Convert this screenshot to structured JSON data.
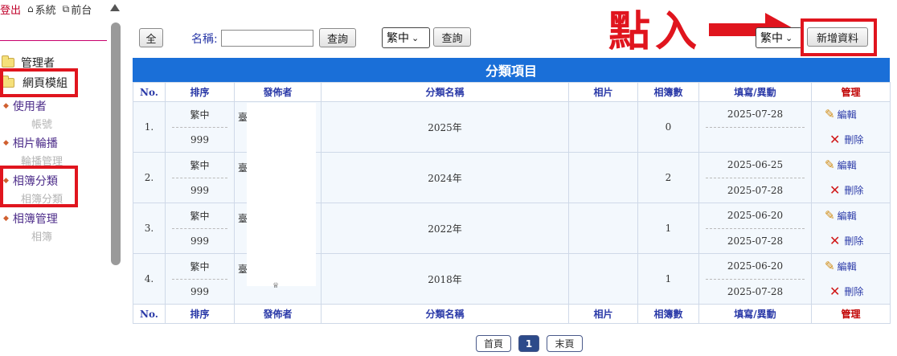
{
  "sidebar": {
    "logout": "登出",
    "system": "系統",
    "frontend": "前台",
    "folders": {
      "admin": "管理者",
      "web_module": "網頁模組"
    },
    "items": [
      {
        "label": "使用者",
        "sub": "帳號"
      },
      {
        "label": "相片輪播",
        "sub": "輪播管理"
      },
      {
        "label": "相簿分類",
        "sub": "相簿分類"
      },
      {
        "label": "相簿管理",
        "sub": "相簿"
      }
    ]
  },
  "toolbar": {
    "all_button": "全",
    "name_label": "名稱:",
    "name_value": "",
    "search_button": "查詢",
    "lang_select": "繁中",
    "search_button_2": "查詢",
    "lang_select_2": "繁中",
    "add_button": "新增資料"
  },
  "annotation": {
    "text": "點入"
  },
  "table": {
    "title": "分類項目",
    "headers": {
      "no": "No.",
      "order": "排序",
      "publisher": "發佈者",
      "category": "分類名稱",
      "photo": "相片",
      "album_count": "相簿數",
      "date": "填寫/異動",
      "manage": "管理"
    },
    "rows": [
      {
        "no": "1.",
        "lang": "繁中",
        "order": "999",
        "publisher": "臺",
        "category": "2025年",
        "photo": "",
        "album_count": "0",
        "created": "2025-07-28",
        "modified": ""
      },
      {
        "no": "2.",
        "lang": "繁中",
        "order": "999",
        "publisher": "臺",
        "category": "2024年",
        "photo": "",
        "album_count": "2",
        "created": "2025-06-25",
        "modified": "2025-07-28"
      },
      {
        "no": "3.",
        "lang": "繁中",
        "order": "999",
        "publisher": "臺",
        "category": "2022年",
        "photo": "",
        "album_count": "1",
        "created": "2025-06-20",
        "modified": "2025-07-28"
      },
      {
        "no": "4.",
        "lang": "繁中",
        "order": "999",
        "publisher": "臺",
        "category": "2018年",
        "photo": "",
        "album_count": "1",
        "created": "2025-06-20",
        "modified": "2025-07-28"
      }
    ],
    "edit_label": "編輯",
    "delete_label": "刪除"
  },
  "pagination": {
    "first": "首頁",
    "current": "1",
    "last": "末頁"
  },
  "colors": {
    "header_blue": "#1a6fd8",
    "annotation_red": "#e0151e",
    "manage_red": "#c00000",
    "link_blue": "#2b3aa8"
  }
}
